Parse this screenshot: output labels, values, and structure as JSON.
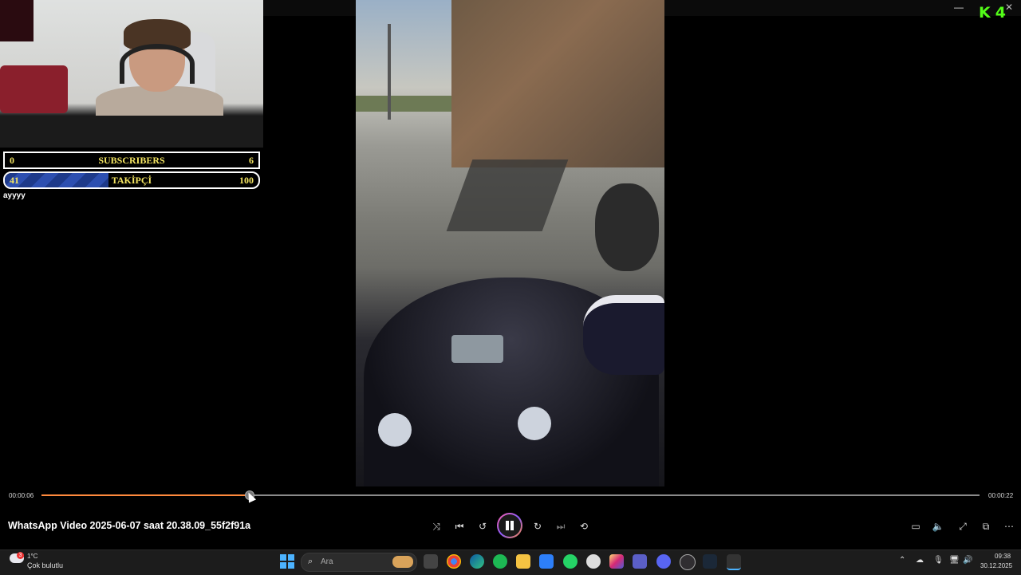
{
  "app": {
    "window_minimize_glyph": "—",
    "window_close_glyph": "✕"
  },
  "overlay": {
    "logo_letter": "K",
    "logo_count": "4",
    "subscribers": {
      "left": "0",
      "label": "SUBSCRIBERS",
      "right": "6"
    },
    "followers": {
      "left": "41",
      "label": "TAKİPÇİ",
      "right": "100",
      "progress_fraction": 0.41
    },
    "chat_message": "ayyyy"
  },
  "player": {
    "title": "WhatsApp Video 2025-06-07 saat 20.38.09_55f2f91a",
    "current_time": "00:00:06",
    "duration": "00:00:22",
    "progress_fraction": 0.2223,
    "state": "playing",
    "accent_color": "#ff8a3d",
    "controls": {
      "shuffle_icon": "shuffle-icon",
      "previous_icon": "previous-icon",
      "rewind_icon": "rewind-10-icon",
      "pause_icon": "pause-icon",
      "forward_icon": "forward-30-icon",
      "next_icon": "next-icon",
      "repeat_icon": "repeat-off-icon",
      "subtitles_icon": "subtitles-icon",
      "volume_icon": "volume-icon",
      "fullscreen_icon": "fullscreen-icon",
      "miniplayer_icon": "miniplayer-icon",
      "more_icon": "more-icon"
    }
  },
  "taskbar": {
    "weather": {
      "badge": "3",
      "temp": "1°C",
      "desc": "Çok bulutlu"
    },
    "search_placeholder": "Ara",
    "apps": [
      "file-explorer-icon",
      "chrome-icon",
      "edge-icon",
      "spotify-icon",
      "folder-icon",
      "store-icon",
      "whatsapp-icon",
      "chatgpt-icon",
      "instagram-icon",
      "teams-icon",
      "discord-icon",
      "obs-icon",
      "steam-icon",
      "media-player-icon"
    ],
    "clock": {
      "time": "09:38",
      "date": "30.12.2025"
    }
  }
}
